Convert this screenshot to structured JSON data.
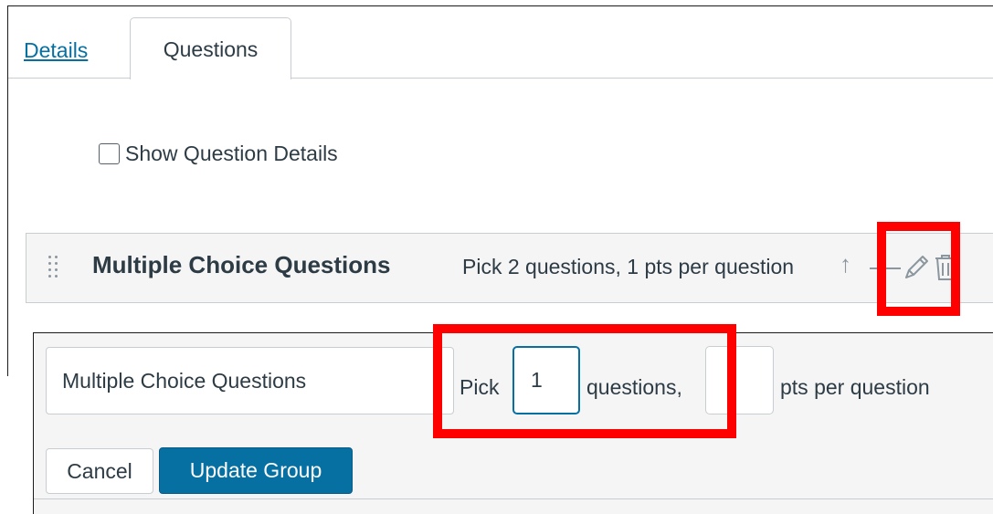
{
  "tabs": [
    {
      "label": "Details",
      "active": false
    },
    {
      "label": "Questions",
      "active": true
    }
  ],
  "options": {
    "show_details_label": "Show Question Details",
    "show_details_checked": false
  },
  "group": {
    "title": "Multiple Choice Questions",
    "info": "Pick 2 questions, 1 pts per question",
    "icons": [
      "drag-handle-icon",
      "arrow-up-icon",
      "pencil-icon",
      "trash-icon"
    ]
  },
  "edit_form": {
    "name_value": "Multiple Choice Questions",
    "pick_label": "Pick",
    "pick_value": "1",
    "questions_label": "questions,",
    "points_value": "",
    "pts_label": "pts per question",
    "cancel_label": "Cancel",
    "update_label": "Update Group"
  },
  "colors": {
    "link": "#0770a3",
    "primary_button": "#0770a3",
    "annotation": "#ff0000",
    "panel_bg": "#f5f5f5"
  }
}
